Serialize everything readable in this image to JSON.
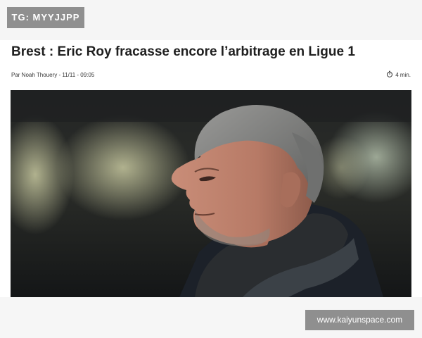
{
  "watermark": {
    "top_label": "TG: MYYJJPP",
    "bottom_label": "www.kaiyunspace.com"
  },
  "article": {
    "title": "Brest : Eric Roy fracasse encore l’arbitrage en Ligue 1",
    "byline": "Par Noah Thouery - 11/11 - 09:05",
    "read_time": "4 min.",
    "read_time_icon": "stopwatch-icon",
    "hero_image": "photo of a grey-haired man in a dark scarf, profile view"
  }
}
